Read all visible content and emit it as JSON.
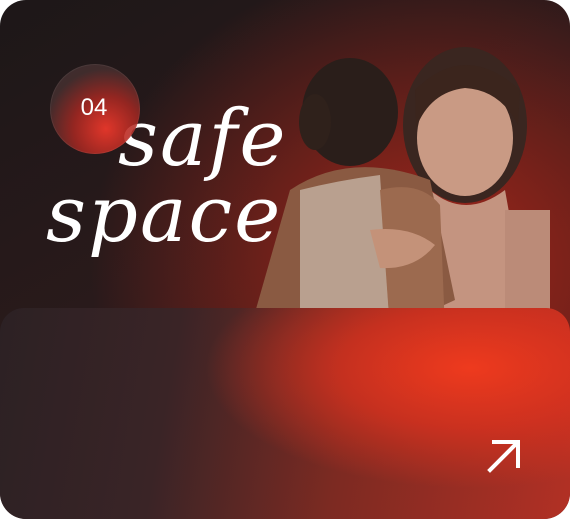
{
  "card": {
    "number": "04",
    "title_line_1": "safe",
    "title_line_2": "space",
    "arrow_icon": "arrow-up-right-icon"
  },
  "colors": {
    "background_dark": "#1d1718",
    "accent_red": "#e0362a",
    "text": "#ffffff"
  }
}
